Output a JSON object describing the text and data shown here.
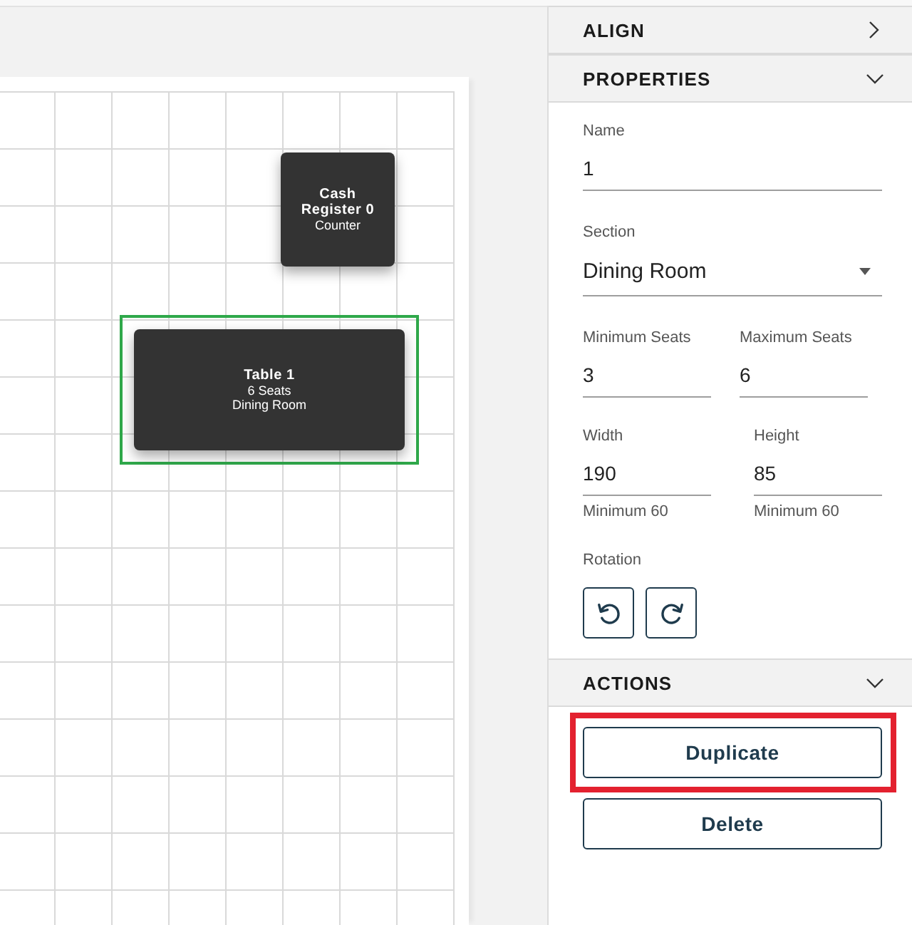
{
  "canvas": {
    "items": [
      {
        "title": "Cash Register 0",
        "details": [
          "Counter"
        ],
        "selected": false
      },
      {
        "title": "Table 1",
        "details": [
          "6 Seats",
          "Dining Room"
        ],
        "selected": true
      }
    ]
  },
  "align": {
    "title": "ALIGN",
    "expanded": false
  },
  "properties": {
    "title": "PROPERTIES",
    "expanded": true,
    "rows": [
      [
        {
          "kind": "text",
          "label": "Name",
          "value": "1"
        }
      ],
      [
        {
          "kind": "select",
          "label": "Section",
          "value": "Dining Room"
        }
      ],
      [
        {
          "kind": "text",
          "label": "Minimum Seats",
          "value": "3"
        },
        {
          "kind": "text",
          "label": "Maximum Seats",
          "value": "6"
        }
      ],
      [
        {
          "kind": "text",
          "label": "Width",
          "value": "190",
          "helper": "Minimum 60"
        },
        {
          "kind": "text",
          "label": "Height",
          "value": "85",
          "helper": "Minimum 60"
        }
      ]
    ],
    "rotation": {
      "label": "Rotation",
      "buttons": [
        {
          "kind": "counterclockwise"
        },
        {
          "kind": "clockwise"
        }
      ]
    }
  },
  "actions": {
    "title": "ACTIONS",
    "expanded": true,
    "buttons": [
      {
        "label": "Duplicate",
        "highlighted": true
      },
      {
        "label": "Delete",
        "highlighted": false
      }
    ]
  }
}
